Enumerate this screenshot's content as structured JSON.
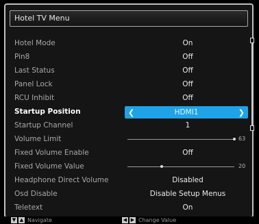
{
  "menu": {
    "title": "Hotel TV Menu",
    "rows": [
      {
        "label": "Hotel Mode",
        "value": "On"
      },
      {
        "label": "Pin8",
        "value": "Off"
      },
      {
        "label": "Last Status",
        "value": "Off"
      },
      {
        "label": "Panel Lock",
        "value": "Off"
      },
      {
        "label": "RCU Inhibit",
        "value": "Off"
      },
      {
        "label": "Startup Position",
        "value": "HDMI1"
      },
      {
        "label": "Startup Channel",
        "value": "1"
      },
      {
        "label": "Volume Limit",
        "value": "63",
        "level_percent": 100
      },
      {
        "label": "Fixed Volume Enable",
        "value": "Off"
      },
      {
        "label": "Fixed Volume Value",
        "value": "20",
        "level_percent": 32
      },
      {
        "label": "Headphone Direct Volume",
        "value": "Disabled"
      },
      {
        "label": "Osd Disable",
        "value": "Disable Setup Menus"
      },
      {
        "label": "Teletext",
        "value": "On"
      }
    ],
    "selected_index": 5
  },
  "footer": {
    "navigate_label": "Navigate",
    "change_value_label": "Change Value"
  },
  "colors": {
    "selection": "#1fa3e8",
    "background": "#151515",
    "border": "#bfbfbf"
  }
}
